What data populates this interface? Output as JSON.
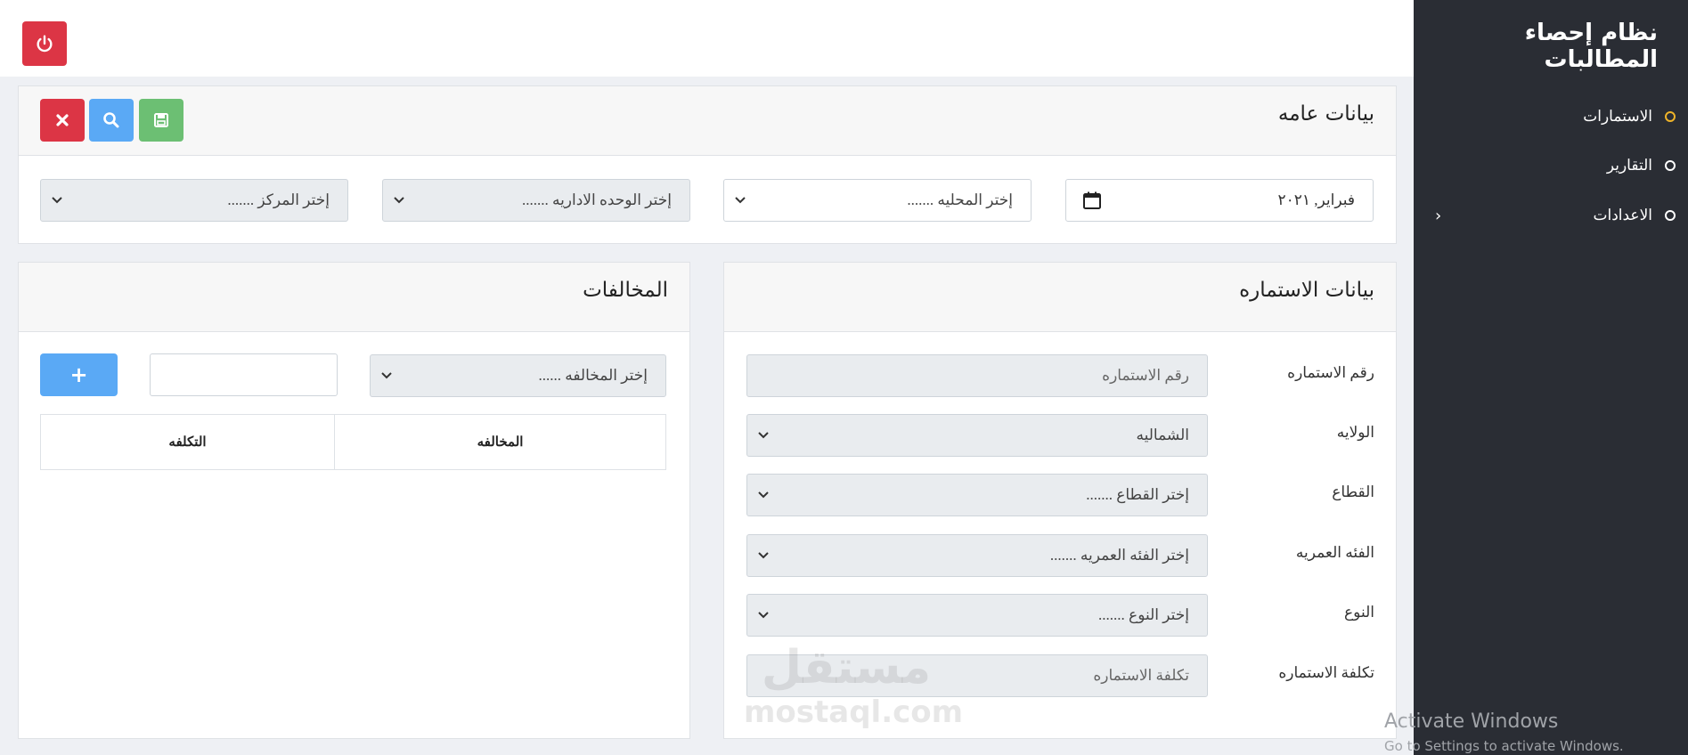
{
  "sidebar": {
    "title": "نظام إحصاء المطالبات",
    "items": [
      {
        "label": "الاستمارات",
        "active": true
      },
      {
        "label": "التقارير",
        "active": false
      },
      {
        "label": "الاعدادات",
        "active": false,
        "has_submenu": true
      }
    ]
  },
  "topbar": {
    "power_icon": "power-icon"
  },
  "general": {
    "title": "بيانات عامه",
    "date_value": "فبراير, ٢٠٢١",
    "locality_placeholder": "إختر المحليه .......",
    "admin_unit_placeholder": "إختر الوحده الاداريه .......",
    "center_placeholder": "إختر المركز ......."
  },
  "form": {
    "title": "بيانات الاستماره",
    "fields": [
      {
        "label": "رقم الاستماره",
        "value": "رقم الاستماره"
      },
      {
        "label": "الولايه",
        "value": "الشماليه"
      },
      {
        "label": "القطاع",
        "value": "إختر القطاع ......."
      },
      {
        "label": "الفئه العمريه",
        "value": "إختر الفئه العمريه ......."
      },
      {
        "label": "النوع",
        "value": "إختر النوع ......."
      },
      {
        "label": "تكلفة الاستماره",
        "value": "تكلفة الاستماره"
      }
    ]
  },
  "violations": {
    "title": "المخالفات",
    "select_placeholder": "إختر المخالفه ......",
    "add_label": "+",
    "columns": [
      "المخالفه",
      "التكلفه"
    ]
  },
  "watermark": {
    "arabic": "مستقل",
    "latin": "mostaql.com"
  },
  "os_notice": {
    "line1": "Activate Windows",
    "line2": "Go to Settings to activate Windows."
  },
  "colors": {
    "sidebar": "#2a2d34",
    "active_dot": "#f0b429",
    "danger": "#dc3545",
    "info": "#5aa9f5",
    "success": "#6cbf73"
  }
}
